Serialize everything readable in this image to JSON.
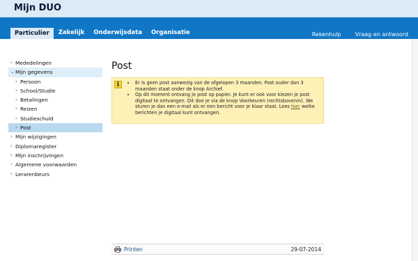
{
  "app": {
    "title": "Mijn DUO"
  },
  "nav": {
    "tabs": [
      {
        "label": "Particulier"
      },
      {
        "label": "Zakelijk"
      },
      {
        "label": "Onderwijsdata"
      },
      {
        "label": "Organisatie"
      }
    ],
    "right_links": [
      {
        "label": "Rekenhulp"
      },
      {
        "label": "Vraag en antwoord"
      }
    ]
  },
  "sidebar": {
    "items": [
      {
        "label": "Mededelingen",
        "level": 0,
        "chevron": "›"
      },
      {
        "label": "Mijn gegevens",
        "level": 0,
        "chevron": "⌄"
      },
      {
        "label": "Persoon",
        "level": 1,
        "chevron": "›"
      },
      {
        "label": "School/Studie",
        "level": 1,
        "chevron": "›"
      },
      {
        "label": "Betalingen",
        "level": 1,
        "chevron": "›"
      },
      {
        "label": "Reizen",
        "level": 1,
        "chevron": "›"
      },
      {
        "label": "Studieschuld",
        "level": 1,
        "chevron": "›"
      },
      {
        "label": "Post",
        "level": 1,
        "chevron": "›"
      },
      {
        "label": "Mijn wijzigingen",
        "level": 0,
        "chevron": "›"
      },
      {
        "label": "Diplomaregister",
        "level": 0,
        "chevron": "›"
      },
      {
        "label": "Mijn inschrijvingen",
        "level": 0,
        "chevron": "›"
      },
      {
        "label": "Algemene voorwaarden",
        "level": 0,
        "chevron": "›"
      },
      {
        "label": "Lerarenbeurs",
        "level": 0,
        "chevron": "›"
      }
    ]
  },
  "main": {
    "title": "Post",
    "notice": {
      "icon": "i",
      "bullet1": "Er is geen post aanwezig van de afgelopen 3 maanden. Post ouder dan 3 maanden staat onder de knop Archief.",
      "bullet2_before": "Op dit moment ontvang je post op papier. Je kunt er ook voor kiezen je post digitaal te ontvangen. Dit doe je via de knop Voorkeuren (rechtsbovenin). We sturen je dan een e-mail als er een bericht voor je klaar staat. Lees ",
      "bullet2_link": "hier",
      "bullet2_after": " welke berichten je digitaal kunt ontvangen."
    },
    "footer": {
      "print_label": "Printen",
      "date": "29-07-2014"
    }
  },
  "colors": {
    "nav": "#1076c6",
    "topbar": "#dceaf6",
    "notice": "#fdf1b8",
    "active": "#b8d9f0"
  }
}
